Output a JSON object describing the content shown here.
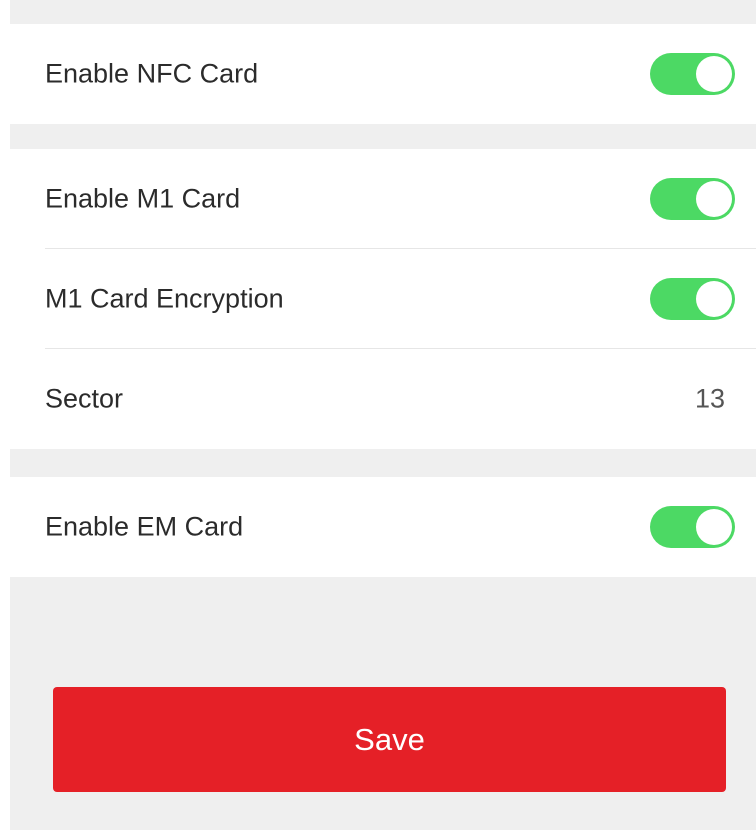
{
  "sections": [
    {
      "rows": [
        {
          "label": "Enable NFC Card",
          "toggle": true
        }
      ]
    },
    {
      "rows": [
        {
          "label": "Enable M1 Card",
          "toggle": true
        },
        {
          "label": "M1 Card Encryption",
          "toggle": true
        },
        {
          "label": "Sector",
          "value": "13"
        }
      ]
    },
    {
      "rows": [
        {
          "label": "Enable EM Card",
          "toggle": true
        }
      ]
    }
  ],
  "save_label": "Save",
  "colors": {
    "toggle_on": "#4cd964",
    "save_button": "#e52027",
    "background": "#efefef"
  }
}
